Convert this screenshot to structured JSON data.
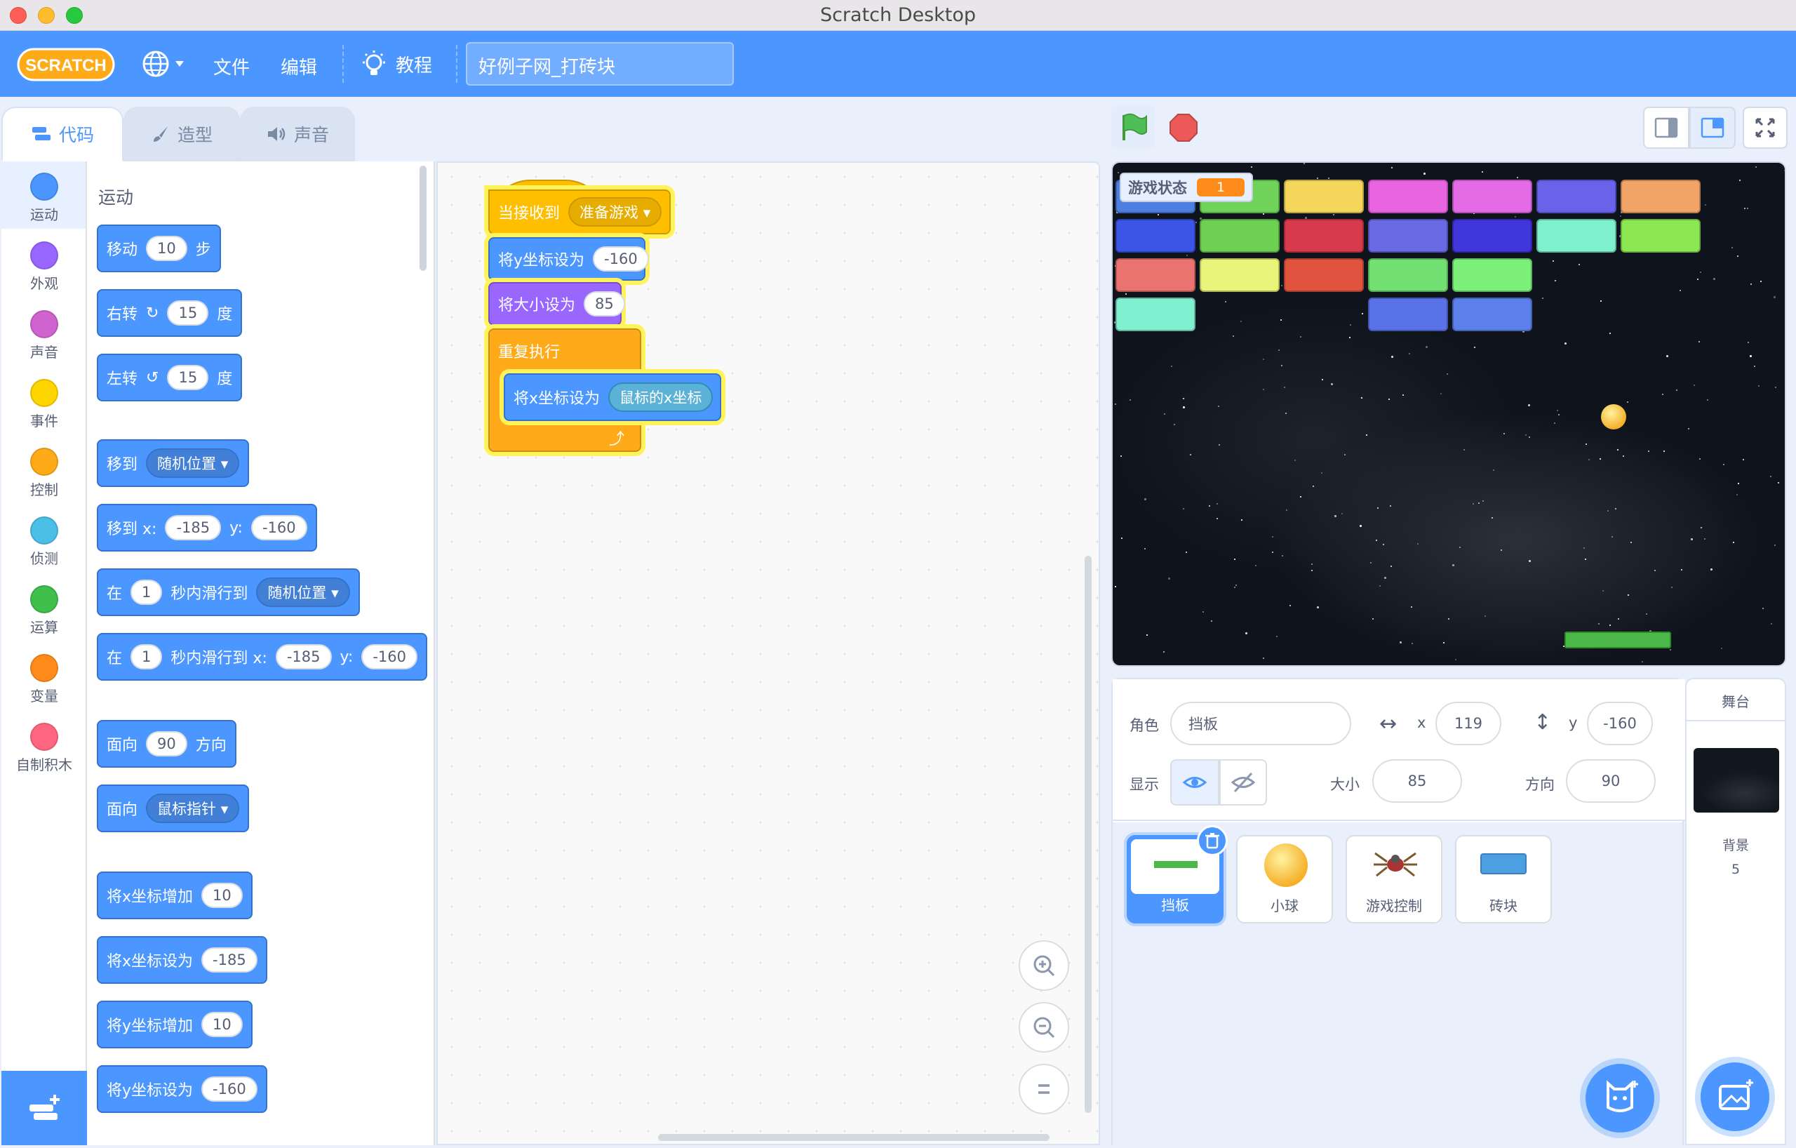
{
  "window": {
    "title": "Scratch Desktop"
  },
  "menu": {
    "file": "文件",
    "edit": "编辑",
    "tutorials": "教程",
    "project_name": "好例子网_打砖块",
    "logo_text": "SCRATCH"
  },
  "tabs": {
    "code": "代码",
    "costumes": "造型",
    "sounds": "声音"
  },
  "categories": [
    {
      "label": "运动",
      "color": "#4c97ff"
    },
    {
      "label": "外观",
      "color": "#9966ff"
    },
    {
      "label": "声音",
      "color": "#cf63cf"
    },
    {
      "label": "事件",
      "color": "#ffd500"
    },
    {
      "label": "控制",
      "color": "#ffab19"
    },
    {
      "label": "侦测",
      "color": "#4cbfe6"
    },
    {
      "label": "运算",
      "color": "#40bf4a"
    },
    {
      "label": "变量",
      "color": "#ff8c1a"
    },
    {
      "label": "自制积木",
      "color": "#ff6680"
    }
  ],
  "palette": {
    "heading": "运动",
    "move": {
      "a": "移动",
      "v": "10",
      "b": "步"
    },
    "turn_right": {
      "a": "右转",
      "v": "15",
      "b": "度"
    },
    "turn_left": {
      "a": "左转",
      "v": "15",
      "b": "度"
    },
    "goto": {
      "a": "移到",
      "d": "随机位置"
    },
    "goto_xy": {
      "a": "移到 x:",
      "x": "-185",
      "ylab": "y:",
      "y": "-160"
    },
    "glide": {
      "a": "在",
      "v": "1",
      "b": "秒内滑行到",
      "d": "随机位置"
    },
    "glide_xy": {
      "a": "在",
      "v": "1",
      "b": "秒内滑行到 x:",
      "x": "-185",
      "ylab": "y:",
      "y": "-160"
    },
    "point_dir": {
      "a": "面向",
      "v": "90",
      "b": "方向"
    },
    "point_towards": {
      "a": "面向",
      "d": "鼠标指针"
    },
    "change_x": {
      "a": "将x坐标增加",
      "v": "10"
    },
    "set_x": {
      "a": "将x坐标设为",
      "v": "-185"
    },
    "change_y": {
      "a": "将y坐标增加",
      "v": "10"
    },
    "set_y": {
      "a": "将y坐标设为",
      "v": "-160"
    }
  },
  "script": {
    "hat": {
      "a": "当接收到",
      "d": "准备游戏"
    },
    "set_y": {
      "a": "将y坐标设为",
      "v": "-160"
    },
    "set_size": {
      "a": "将大小设为",
      "v": "85"
    },
    "forever": "重复执行",
    "set_x": {
      "a": "将x坐标设为",
      "r": "鼠标的x坐标"
    }
  },
  "stage": {
    "monitor_label": "游戏状态",
    "monitor_value": "1",
    "bricks": [
      {
        "row": 0,
        "col": 0,
        "color": "#4c7fe0"
      },
      {
        "row": 0,
        "col": 1,
        "color": "#6fd35a"
      },
      {
        "row": 0,
        "col": 2,
        "color": "#f5d55a"
      },
      {
        "row": 0,
        "col": 3,
        "color": "#e864e0"
      },
      {
        "row": 0,
        "col": 4,
        "color": "#e46be6"
      },
      {
        "row": 0,
        "col": 5,
        "color": "#6b62ea"
      },
      {
        "row": 0,
        "col": 6,
        "color": "#f2a368"
      },
      {
        "row": 1,
        "col": 0,
        "color": "#3b55e6"
      },
      {
        "row": 1,
        "col": 1,
        "color": "#6ed052"
      },
      {
        "row": 1,
        "col": 2,
        "color": "#d73a4a"
      },
      {
        "row": 1,
        "col": 3,
        "color": "#6a6ae4"
      },
      {
        "row": 1,
        "col": 4,
        "color": "#4135dc"
      },
      {
        "row": 1,
        "col": 5,
        "color": "#7df0ce"
      },
      {
        "row": 1,
        "col": 6,
        "color": "#8be852"
      },
      {
        "row": 2,
        "col": 0,
        "color": "#ec7470"
      },
      {
        "row": 2,
        "col": 1,
        "color": "#e8f47a"
      },
      {
        "row": 2,
        "col": 2,
        "color": "#e0533e"
      },
      {
        "row": 2,
        "col": 3,
        "color": "#72e072"
      },
      {
        "row": 2,
        "col": 4,
        "color": "#7df07a"
      },
      {
        "row": 3,
        "col": 0,
        "color": "#7ff0d0"
      },
      {
        "row": 3,
        "col": 3,
        "color": "#5a72e8"
      },
      {
        "row": 3,
        "col": 4,
        "color": "#5c80ea"
      }
    ]
  },
  "sprite_info": {
    "sprite_label": "角色",
    "sprite_name": "挡板",
    "x_label": "x",
    "x": "119",
    "y_label": "y",
    "y": "-160",
    "show_label": "显示",
    "size_label": "大小",
    "size": "85",
    "direction_label": "方向",
    "direction": "90"
  },
  "sprites": [
    {
      "name": "挡板",
      "selected": true
    },
    {
      "name": "小球",
      "selected": false
    },
    {
      "name": "游戏控制",
      "selected": false
    },
    {
      "name": "砖块",
      "selected": false
    }
  ],
  "stage_card": {
    "title": "舞台",
    "backdrops_label": "背景",
    "backdrops_count": "5"
  },
  "colors": {
    "accent": "#4c97ff",
    "motion": "#4c97ff",
    "events": "#ffbf00",
    "control": "#ffab19",
    "looks": "#9966ff",
    "sensing": "#5cb1d6"
  }
}
